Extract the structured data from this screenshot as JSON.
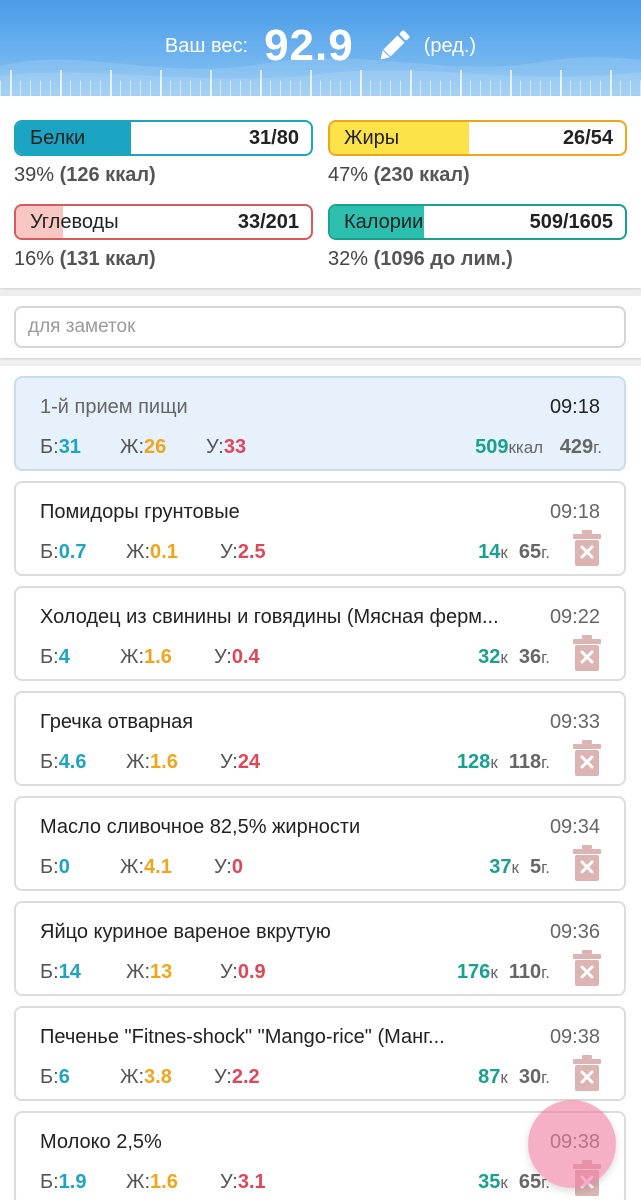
{
  "header": {
    "weight_label": "Ваш вес:",
    "weight_value": "92.9",
    "edit_label": "(ред.)"
  },
  "macros": {
    "protein": {
      "name": "Белки",
      "value": "31/80",
      "fill_fraction": 0.39,
      "sub_pct": "39%",
      "sub_detail": "(126 ккал)",
      "color": "#1ba5c2",
      "border": "#1ba5c2"
    },
    "fat": {
      "name": "Жиры",
      "value": "26/54",
      "fill_fraction": 0.47,
      "sub_pct": "47%",
      "sub_detail": "(230 ккал)",
      "color": "#fde34a",
      "border": "#f0a51b"
    },
    "carbs": {
      "name": "Углеводы",
      "value": "33/201",
      "fill_fraction": 0.16,
      "sub_pct": "16%",
      "sub_detail": "(131 ккал)",
      "color": "#f8c7c3",
      "border": "#d85a5a"
    },
    "calories": {
      "name": "Калории",
      "value": "509/1605",
      "fill_fraction": 0.32,
      "sub_pct": "32%",
      "sub_detail": "(1096 до лим.)",
      "color": "#2dbfae",
      "border": "#17a28e"
    }
  },
  "notes": {
    "placeholder": "для заметок"
  },
  "summary": {
    "title": "1-й прием пищи",
    "time": "09:18",
    "p_label": "Б:",
    "p": "31",
    "f_label": "Ж:",
    "f": "26",
    "c_label": "У:",
    "c": "33",
    "kcal": "509",
    "kcal_unit": "ккал",
    "grams": "429",
    "grams_unit": "г."
  },
  "items": [
    {
      "title": "Помидоры грунтовые",
      "time": "09:18",
      "p": "0.7",
      "f": "0.1",
      "c": "2.5",
      "kcal": "14",
      "grams": "65"
    },
    {
      "title": "Холодец из свинины и говядины (Мясная ферм...",
      "time": "09:22",
      "p": "4",
      "f": "1.6",
      "c": "0.4",
      "kcal": "32",
      "grams": "36"
    },
    {
      "title": "Гречка отварная",
      "time": "09:33",
      "p": "4.6",
      "f": "1.6",
      "c": "24",
      "kcal": "128",
      "grams": "118"
    },
    {
      "title": "Масло сливочное 82,5% жирности",
      "time": "09:34",
      "p": "0",
      "f": "4.1",
      "c": "0",
      "kcal": "37",
      "grams": "5"
    },
    {
      "title": "Яйцо куриное вареное вкрутую",
      "time": "09:36",
      "p": "14",
      "f": "13",
      "c": "0.9",
      "kcal": "176",
      "grams": "110"
    },
    {
      "title": "Печенье \"Fitnes-shock\" \"Mango-rice\" (Манг...",
      "time": "09:38",
      "p": "6",
      "f": "3.8",
      "c": "2.2",
      "kcal": "87",
      "grams": "30"
    },
    {
      "title": "Молоко 2,5%",
      "time": "09:38",
      "p": "1.9",
      "f": "1.6",
      "c": "3.1",
      "kcal": "35",
      "grams": "65"
    }
  ],
  "labels": {
    "p": "Б:",
    "f": "Ж:",
    "c": "У:",
    "kcal_short": "к",
    "grams_unit": "г."
  }
}
